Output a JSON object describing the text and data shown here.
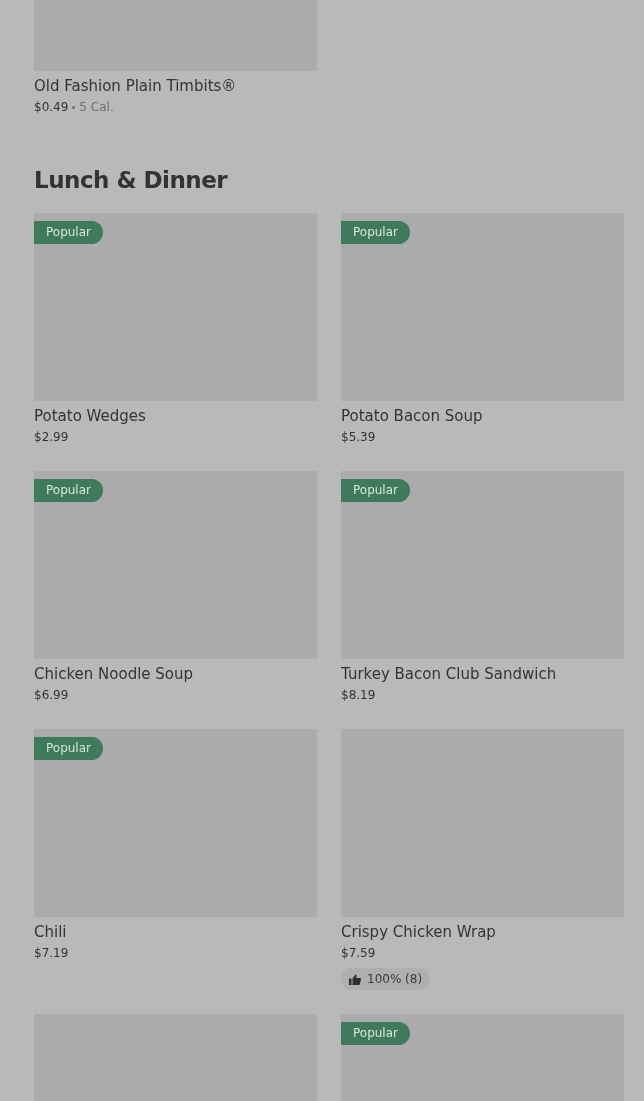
{
  "top_item": {
    "name": "Old Fashion Plain Timbits®",
    "price": "$0.49",
    "calories": "5 Cal."
  },
  "section": {
    "title": "Lunch & Dinner",
    "items": [
      {
        "kind": "card",
        "name": "Potato Wedges",
        "price": "$2.99",
        "badge": "Popular"
      },
      {
        "kind": "card",
        "name": "Potato Bacon Soup",
        "price": "$5.39",
        "badge": "Popular"
      },
      {
        "kind": "card",
        "name": "Chicken Noodle Soup",
        "price": "$6.99",
        "badge": "Popular"
      },
      {
        "kind": "card",
        "name": "Turkey Bacon Club Sandwich",
        "price": "$8.19",
        "badge": "Popular"
      },
      {
        "kind": "card",
        "name": "Chili",
        "price": "$7.19",
        "badge": "Popular"
      },
      {
        "kind": "card",
        "name": "Crispy Chicken Wrap",
        "price": "$7.59",
        "rating": "100% (8)"
      },
      {
        "kind": "card"
      },
      {
        "kind": "card",
        "badge": "Popular"
      }
    ]
  }
}
